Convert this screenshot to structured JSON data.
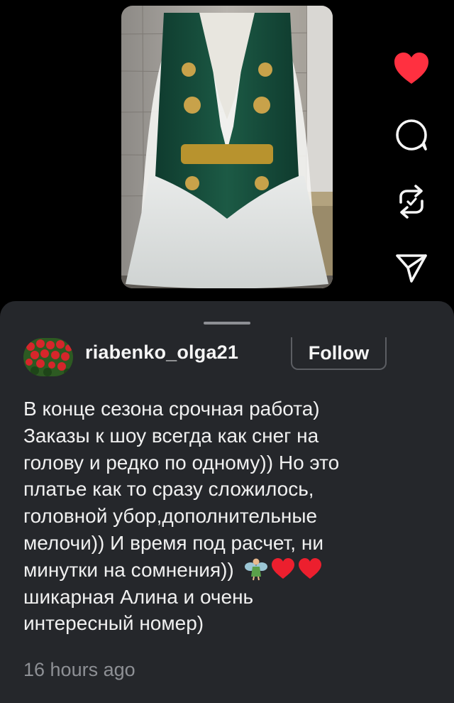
{
  "post": {
    "image_alt_icon": "post-photo-folk-costume"
  },
  "actions": [
    {
      "name": "like",
      "icon": "heart-filled-icon",
      "color": "#ff3040"
    },
    {
      "name": "comment",
      "icon": "comment-bubble-icon"
    },
    {
      "name": "repost",
      "icon": "repost-arrows-icon"
    },
    {
      "name": "share",
      "icon": "paper-plane-icon"
    }
  ],
  "sheet": {
    "username": "riabenko_olga21",
    "follow_label": "Follow",
    "caption_lines": [
      "В конце сезона срочная работа)",
      "Заказы к шоу всегда как снег на",
      "голову и редко по одному)) Но это",
      "платье как то сразу сложилось,",
      "головной убор,дополнительные",
      "мелочи)) И время под расчет, ни",
      "минутки на сомнения))",
      "шикарная Алина и очень",
      "интересный номер)"
    ],
    "caption_emojis": [
      "fairy-emoji",
      "red-heart-emoji",
      "red-heart-emoji"
    ],
    "timestamp": "16 hours ago"
  },
  "colors": {
    "background": "#000000",
    "sheet": "#25272b",
    "like_red": "#ff3040",
    "muted_text": "#8e9095"
  }
}
